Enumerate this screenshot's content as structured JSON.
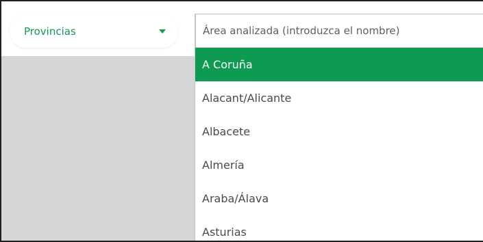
{
  "colors": {
    "accent_green": "#139a55",
    "selected_row_bg": "#0f9a52",
    "panel_gray": "#d4d6d8"
  },
  "province_select": {
    "label": "Provincias",
    "caret_icon": "caret-down-icon"
  },
  "area_search": {
    "placeholder": "Área analizada (introduzca el nombre)",
    "value": ""
  },
  "options": [
    {
      "label": "A Coruña",
      "selected": true
    },
    {
      "label": "Alacant/Alicante",
      "selected": false
    },
    {
      "label": "Albacete",
      "selected": false
    },
    {
      "label": "Almería",
      "selected": false
    },
    {
      "label": "Araba/Álava",
      "selected": false
    },
    {
      "label": "Asturias",
      "selected": false
    }
  ]
}
